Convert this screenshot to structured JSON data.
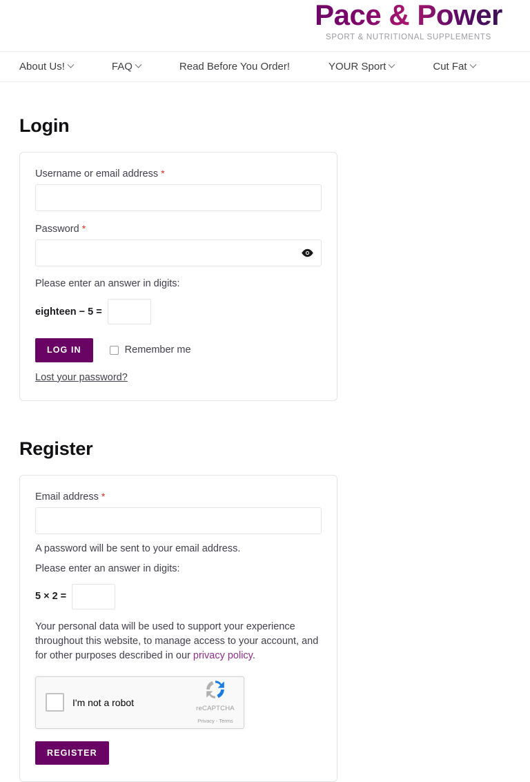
{
  "header": {
    "brand_title": "Pace & Power",
    "brand_tagline": "Sport & Nutritional Supplements"
  },
  "nav": {
    "items": [
      {
        "label": "About Us!",
        "has_dropdown": true
      },
      {
        "label": "FAQ",
        "has_dropdown": true
      },
      {
        "label": "Read Before You Order!",
        "has_dropdown": false
      },
      {
        "label": "YOUR Sport",
        "has_dropdown": true
      },
      {
        "label": "Cut Fat",
        "has_dropdown": true
      }
    ]
  },
  "login": {
    "title": "Login",
    "username_label": "Username or email address",
    "username_required": "*",
    "username_value": "",
    "password_label": "Password",
    "password_required": "*",
    "password_value": "",
    "show_password_icon": "eye-icon",
    "captcha_prompt": "Please enter an answer in digits:",
    "captcha_question": "eighteen − 5 =",
    "captcha_value": "",
    "submit_label": "Log in",
    "remember_label": "Remember me",
    "remember_checked": false,
    "lost_password_label": "Lost your password?"
  },
  "register": {
    "title": "Register",
    "email_label": "Email address",
    "email_required": "*",
    "email_value": "",
    "email_helper": "A password will be sent to your email address.",
    "captcha_prompt": "Please enter an answer in digits:",
    "captcha_question": "5 × 2 =",
    "captcha_value": "",
    "privacy_text_before": "Your personal data will be used to support your experience throughout this website, to manage access to your account, and for other purposes described in our ",
    "privacy_link_label": "privacy policy",
    "privacy_text_after": ".",
    "submit_label": "Register"
  },
  "recaptcha": {
    "checkbox_checked": false,
    "label": "I'm not a robot",
    "brand_name": "reCAPTCHA",
    "links": "Privacy - Terms"
  },
  "colors": {
    "brand_purple": "#6a0464",
    "accent_link": "#8e2f8a",
    "required_red": "#e02b20"
  }
}
